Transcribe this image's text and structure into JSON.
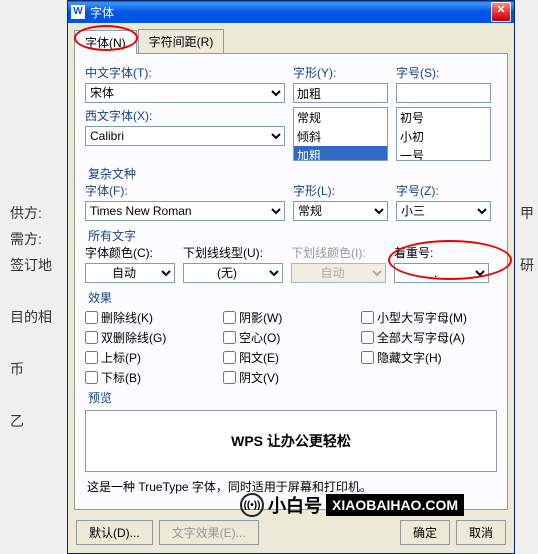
{
  "window": {
    "title": "字体"
  },
  "tabs": {
    "font": "字体(N)",
    "spacing": "字符间距(R)"
  },
  "labels": {
    "cnFont": "中文字体(T):",
    "westFont": "西文字体(X):",
    "style": "字形(Y):",
    "size": "字号(S):",
    "complexLegend": "复杂文种",
    "cxFont": "字体(F):",
    "cxStyle": "字形(L):",
    "cxSize": "字号(Z):",
    "allTextLegend": "所有文字",
    "fontColor": "字体颜色(C):",
    "underline": "下划线线型(U):",
    "underlineColor": "下划线颜色(I):",
    "emphasis": "着重号:",
    "effectsLegend": "效果",
    "previewLegend": "预览"
  },
  "values": {
    "cnFont": "宋体",
    "westFont": "Calibri",
    "style": "加粗",
    "size": "",
    "cxFont": "Times New Roman",
    "cxStyle": "常规",
    "cxSize": "小三",
    "fontColor": "自动",
    "underline": "(无)",
    "underlineColor": "自动",
    "emphasis": "."
  },
  "styleList": [
    "常规",
    "倾斜",
    "加粗"
  ],
  "sizeList": [
    "初号",
    "小初",
    "一号"
  ],
  "effects": {
    "strike": "删除线(K)",
    "dblstrike": "双删除线(G)",
    "super": "上标(P)",
    "sub": "下标(B)",
    "shadow": "阴影(W)",
    "hollow": "空心(O)",
    "emboss": "阳文(E)",
    "engrave": "阴文(V)",
    "smallcaps": "小型大写字母(M)",
    "allcaps": "全部大写字母(A)",
    "hidden": "隐藏文字(H)"
  },
  "preview": {
    "text": "WPS 让办公更轻松",
    "desc": "这是一种 TrueType 字体，同时适用于屏幕和打印机。"
  },
  "buttons": {
    "default": "默认(D)...",
    "texteffects": "文字效果(E)...",
    "ok": "确定",
    "cancel": "取消"
  },
  "bgtext": {
    "l1": "供方:",
    "l2": "需方:",
    "l3": "签订地",
    "l4": "目的相",
    "l5": "币",
    "l6": "乙",
    "l7": "甲",
    "l8": "研"
  },
  "brand": {
    "cn": "小白号",
    "url": "XIAOBAIHAO.COM"
  }
}
